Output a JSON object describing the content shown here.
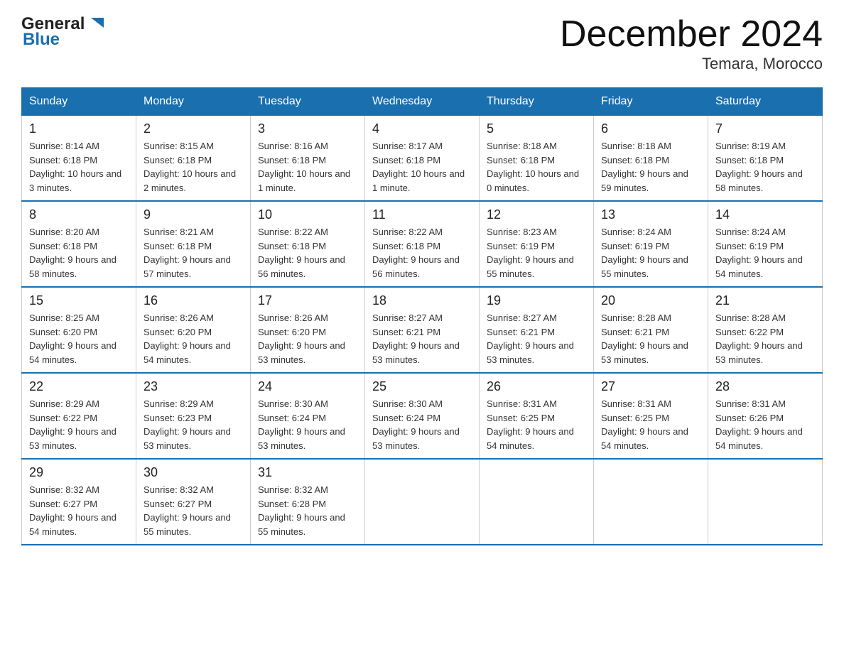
{
  "header": {
    "logo_general": "General",
    "logo_blue": "Blue",
    "title": "December 2024",
    "location": "Temara, Morocco"
  },
  "days_of_week": [
    "Sunday",
    "Monday",
    "Tuesday",
    "Wednesday",
    "Thursday",
    "Friday",
    "Saturday"
  ],
  "weeks": [
    [
      {
        "day": "1",
        "sunrise": "8:14 AM",
        "sunset": "6:18 PM",
        "daylight": "10 hours and 3 minutes."
      },
      {
        "day": "2",
        "sunrise": "8:15 AM",
        "sunset": "6:18 PM",
        "daylight": "10 hours and 2 minutes."
      },
      {
        "day": "3",
        "sunrise": "8:16 AM",
        "sunset": "6:18 PM",
        "daylight": "10 hours and 1 minute."
      },
      {
        "day": "4",
        "sunrise": "8:17 AM",
        "sunset": "6:18 PM",
        "daylight": "10 hours and 1 minute."
      },
      {
        "day": "5",
        "sunrise": "8:18 AM",
        "sunset": "6:18 PM",
        "daylight": "10 hours and 0 minutes."
      },
      {
        "day": "6",
        "sunrise": "8:18 AM",
        "sunset": "6:18 PM",
        "daylight": "9 hours and 59 minutes."
      },
      {
        "day": "7",
        "sunrise": "8:19 AM",
        "sunset": "6:18 PM",
        "daylight": "9 hours and 58 minutes."
      }
    ],
    [
      {
        "day": "8",
        "sunrise": "8:20 AM",
        "sunset": "6:18 PM",
        "daylight": "9 hours and 58 minutes."
      },
      {
        "day": "9",
        "sunrise": "8:21 AM",
        "sunset": "6:18 PM",
        "daylight": "9 hours and 57 minutes."
      },
      {
        "day": "10",
        "sunrise": "8:22 AM",
        "sunset": "6:18 PM",
        "daylight": "9 hours and 56 minutes."
      },
      {
        "day": "11",
        "sunrise": "8:22 AM",
        "sunset": "6:18 PM",
        "daylight": "9 hours and 56 minutes."
      },
      {
        "day": "12",
        "sunrise": "8:23 AM",
        "sunset": "6:19 PM",
        "daylight": "9 hours and 55 minutes."
      },
      {
        "day": "13",
        "sunrise": "8:24 AM",
        "sunset": "6:19 PM",
        "daylight": "9 hours and 55 minutes."
      },
      {
        "day": "14",
        "sunrise": "8:24 AM",
        "sunset": "6:19 PM",
        "daylight": "9 hours and 54 minutes."
      }
    ],
    [
      {
        "day": "15",
        "sunrise": "8:25 AM",
        "sunset": "6:20 PM",
        "daylight": "9 hours and 54 minutes."
      },
      {
        "day": "16",
        "sunrise": "8:26 AM",
        "sunset": "6:20 PM",
        "daylight": "9 hours and 54 minutes."
      },
      {
        "day": "17",
        "sunrise": "8:26 AM",
        "sunset": "6:20 PM",
        "daylight": "9 hours and 53 minutes."
      },
      {
        "day": "18",
        "sunrise": "8:27 AM",
        "sunset": "6:21 PM",
        "daylight": "9 hours and 53 minutes."
      },
      {
        "day": "19",
        "sunrise": "8:27 AM",
        "sunset": "6:21 PM",
        "daylight": "9 hours and 53 minutes."
      },
      {
        "day": "20",
        "sunrise": "8:28 AM",
        "sunset": "6:21 PM",
        "daylight": "9 hours and 53 minutes."
      },
      {
        "day": "21",
        "sunrise": "8:28 AM",
        "sunset": "6:22 PM",
        "daylight": "9 hours and 53 minutes."
      }
    ],
    [
      {
        "day": "22",
        "sunrise": "8:29 AM",
        "sunset": "6:22 PM",
        "daylight": "9 hours and 53 minutes."
      },
      {
        "day": "23",
        "sunrise": "8:29 AM",
        "sunset": "6:23 PM",
        "daylight": "9 hours and 53 minutes."
      },
      {
        "day": "24",
        "sunrise": "8:30 AM",
        "sunset": "6:24 PM",
        "daylight": "9 hours and 53 minutes."
      },
      {
        "day": "25",
        "sunrise": "8:30 AM",
        "sunset": "6:24 PM",
        "daylight": "9 hours and 53 minutes."
      },
      {
        "day": "26",
        "sunrise": "8:31 AM",
        "sunset": "6:25 PM",
        "daylight": "9 hours and 54 minutes."
      },
      {
        "day": "27",
        "sunrise": "8:31 AM",
        "sunset": "6:25 PM",
        "daylight": "9 hours and 54 minutes."
      },
      {
        "day": "28",
        "sunrise": "8:31 AM",
        "sunset": "6:26 PM",
        "daylight": "9 hours and 54 minutes."
      }
    ],
    [
      {
        "day": "29",
        "sunrise": "8:32 AM",
        "sunset": "6:27 PM",
        "daylight": "9 hours and 54 minutes."
      },
      {
        "day": "30",
        "sunrise": "8:32 AM",
        "sunset": "6:27 PM",
        "daylight": "9 hours and 55 minutes."
      },
      {
        "day": "31",
        "sunrise": "8:32 AM",
        "sunset": "6:28 PM",
        "daylight": "9 hours and 55 minutes."
      },
      null,
      null,
      null,
      null
    ]
  ]
}
